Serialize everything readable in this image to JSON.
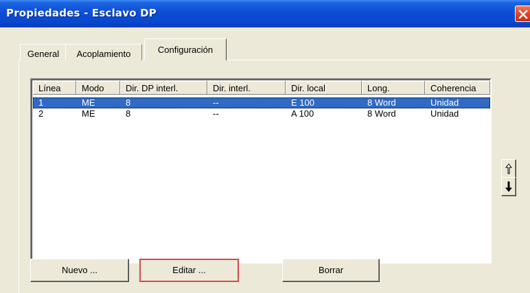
{
  "window": {
    "title": "Propiedades - Esclavo DP",
    "colors": {
      "titlebar": "#0A4FD6",
      "close": "#E0442A",
      "selection": "#316AC5",
      "face": "#ECE9D8"
    }
  },
  "tabs": [
    {
      "label": "General",
      "active": false
    },
    {
      "label": "Acoplamiento",
      "active": false
    },
    {
      "label": "Configuración",
      "active": true
    }
  ],
  "table": {
    "columns": [
      "Línea",
      "Modo",
      "Dir. DP interl.",
      "Dir. interl.",
      "Dir. local",
      "Long.",
      "Coherencia"
    ],
    "rows": [
      {
        "selected": true,
        "cells": [
          "1",
          "ME",
          "8",
          "--",
          "E 100",
          "8 Word",
          "Unidad"
        ]
      },
      {
        "selected": false,
        "cells": [
          "2",
          "ME",
          "8",
          "--",
          "A 100",
          "8 Word",
          "Unidad"
        ]
      }
    ]
  },
  "side_buttons": {
    "up_icon": "arrow-up-icon",
    "down_icon": "arrow-down-icon"
  },
  "buttons": {
    "nuevo": "Nuevo ...",
    "editar": "Editar ...",
    "borrar": "Borrar"
  }
}
